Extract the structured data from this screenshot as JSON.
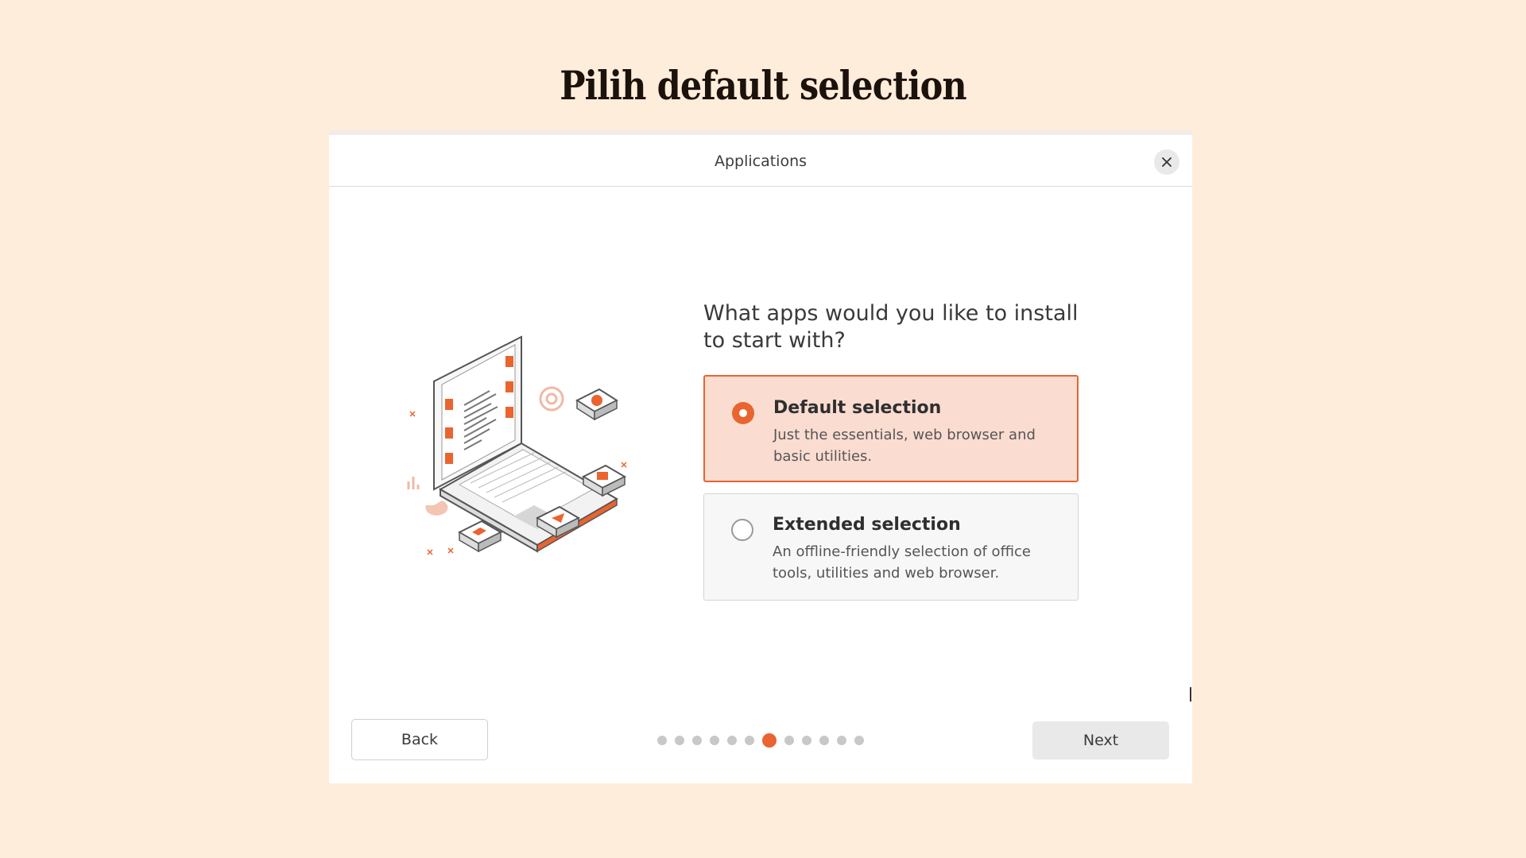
{
  "slide": {
    "title": "Pilih default selection"
  },
  "dialog": {
    "title": "Applications",
    "close_icon": "close-icon",
    "question": "What apps would you like to install to start with?",
    "options": [
      {
        "title": "Default selection",
        "description": "Just the essentials, web browser and basic utilities.",
        "selected": true
      },
      {
        "title": "Extended selection",
        "description": "An offline-friendly selection of office tools, utilities and web browser.",
        "selected": false
      }
    ],
    "back_label": "Back",
    "next_label": "Next",
    "pager": {
      "total": 12,
      "current": 7
    }
  },
  "colors": {
    "accent": "#e9642f",
    "selected_bg": "#fbdcd1",
    "page_bg": "#ffeddb"
  }
}
